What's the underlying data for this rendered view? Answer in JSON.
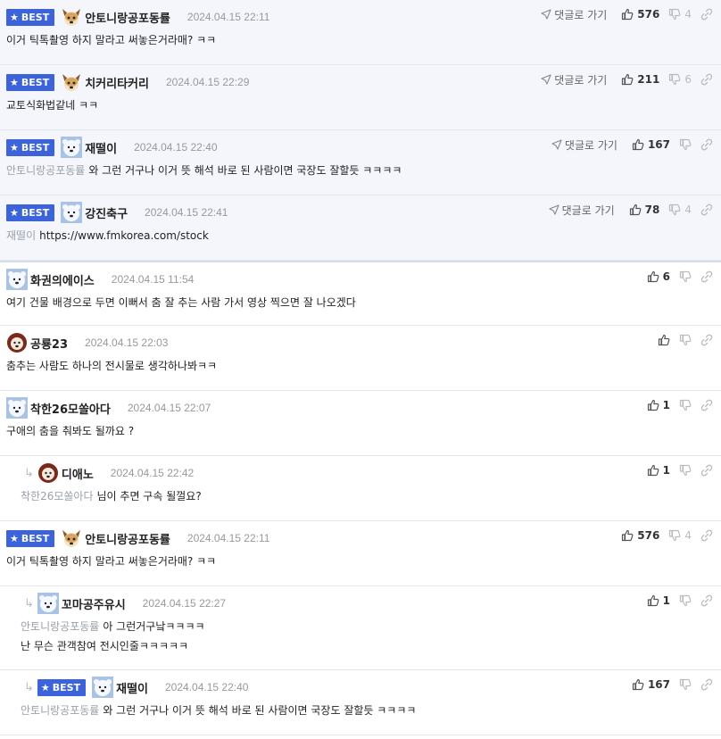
{
  "labels": {
    "best": "BEST",
    "goto_reply": "댓글로 가기"
  },
  "colors": {
    "badge": "#3c63d9",
    "best_bg": "#f4f6fc",
    "mention": "#9aa0ab"
  },
  "comments": [
    {
      "nick": "안토니랑공포동률",
      "date": "2024.04.15 22:11",
      "best": true,
      "avatar": "fox",
      "mention": "",
      "text": "이거 틱톡촬영 하지 말라고 써놓은거라매? ㅋㅋ",
      "up": "576",
      "down": "4"
    },
    {
      "nick": "치커리타커리",
      "date": "2024.04.15 22:29",
      "best": true,
      "avatar": "fox",
      "mention": "",
      "text": "교토식화법같네 ㅋㅋ",
      "up": "211",
      "down": "6"
    },
    {
      "nick": "재떨이",
      "date": "2024.04.15 22:40",
      "best": true,
      "avatar": "bear",
      "mention": "안토니랑공포동률",
      "text": "와 그런 거구나 이거 뜻 해석 바로 된 사람이면 국장도 잘할듯 ㅋㅋㅋㅋ",
      "up": "167",
      "down": ""
    },
    {
      "nick": "강진축구",
      "date": "2024.04.15 22:41",
      "best": true,
      "avatar": "bear",
      "mention": "재떨이",
      "text": "https://www.fmkorea.com/stock",
      "up": "78",
      "down": "4"
    },
    {
      "nick": "화권의에이스",
      "date": "2024.04.15 11:54",
      "avatar": "bear",
      "mention": "",
      "text": "여기 건물 배경으로 두면 이뻐서 춤 잘 추는 사람 가서 영상 찍으면 잘 나오겠다",
      "up": "6",
      "down": ""
    },
    {
      "nick": "공룡23",
      "date": "2024.04.15 22:03",
      "avatar": "lion",
      "mention": "",
      "text": "춤추는 사람도 하나의 전시물로 생각하나봐ㅋㅋ",
      "up": "",
      "down": ""
    },
    {
      "nick": "착한26모쏠아다",
      "date": "2024.04.15 22:07",
      "avatar": "bear",
      "mention": "",
      "text": "구애의 춤을 춰봐도 될까요 ?",
      "up": "1",
      "down": ""
    },
    {
      "nick": "디애노",
      "date": "2024.04.15 22:42",
      "avatar": "lion",
      "mention": "착한26모쏠아다",
      "text": "님이 추면 구속 될껄요?",
      "up": "1",
      "down": ""
    },
    {
      "nick": "안토니랑공포동률",
      "date": "2024.04.15 22:11",
      "best": true,
      "avatar": "fox",
      "mention": "",
      "text": "이거 틱톡촬영 하지 말라고 써놓은거라매? ㅋㅋ",
      "up": "576",
      "down": "4"
    },
    {
      "nick": "꼬마공주유시",
      "date": "2024.04.15 22:27",
      "avatar": "bear",
      "mention": "안토니랑공포동률",
      "text": "아 그런거구낰ㅋㅋㅋㅋ",
      "text2": "난 무슨 관객참여 전시인줄ㅋㅋㅋㅋㅋ",
      "up": "1",
      "down": ""
    },
    {
      "nick": "재떨이",
      "date": "2024.04.15 22:40",
      "best": true,
      "avatar": "bear",
      "mention": "안토니랑공포동률",
      "text": "와 그런 거구나 이거 뜻 해석 바로 된 사람이면 국장도 잘할듯 ㅋㅋㅋㅋ",
      "up": "167",
      "down": ""
    }
  ]
}
